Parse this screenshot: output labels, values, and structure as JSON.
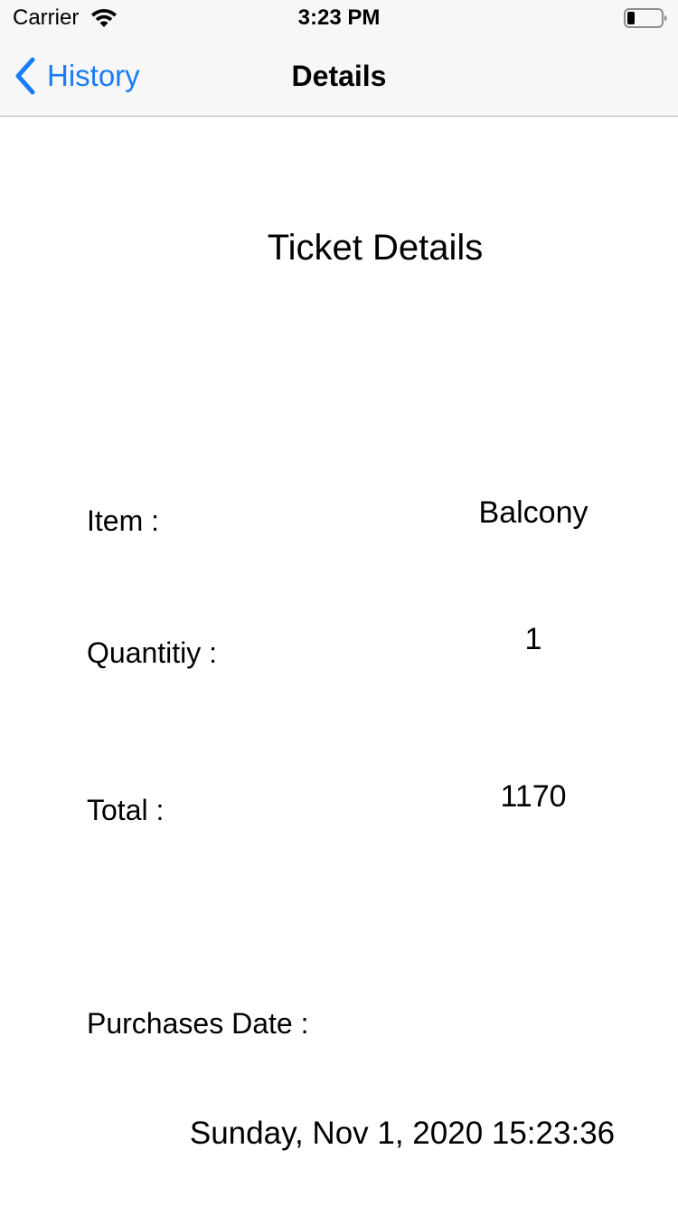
{
  "status_bar": {
    "carrier": "Carrier",
    "time": "3:23 PM",
    "icons": [
      "wifi-icon",
      "battery-icon"
    ]
  },
  "nav": {
    "back_label": "History",
    "title": "Details",
    "accent_color": "#1a7cf5"
  },
  "content": {
    "title": "Ticket Details",
    "item_label": "Item :",
    "item_value": "Balcony",
    "quantity_label": "Quantitiy :",
    "quantity_value": "1",
    "total_label": "Total :",
    "total_value": "1170",
    "date_label": "Purchases Date :",
    "date_value": "Sunday, Nov 1, 2020 15:23:36"
  }
}
